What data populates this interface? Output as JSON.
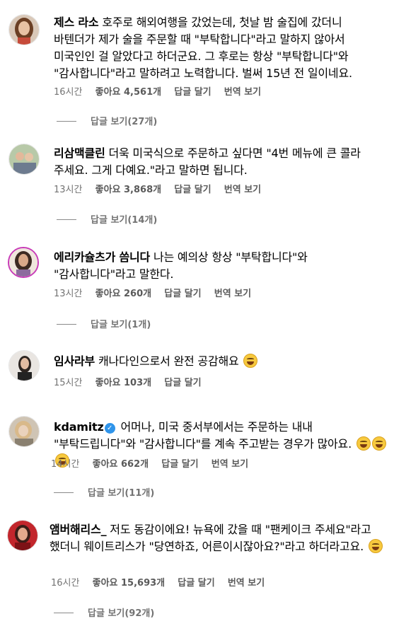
{
  "comments": [
    {
      "username": "제스 라소",
      "text": "호주로 해외여행을 갔었는데, 첫날 밤 술집에 갔더니 바텐더가 제가 술을 주문할 때 \"부탁합니다\"라고 말하지 않아서 미국인인 걸 알았다고 하더군요. 그 후로는 항상 \"부탁합니다\"와 \"감사합니다\"라고 말하려고 노력합니다. 벌써 15년 전 일이네요.",
      "time": "16시간",
      "likes": "좋아요 4,561개",
      "reply": "답글 달기",
      "translate": "번역 보기",
      "view_replies": "답글 보기(27개)"
    },
    {
      "username": "리삼맥클린",
      "text": "더욱 미국식으로 주문하고 싶다면 \"4번 메뉴에 큰 콜라 주세요. 그게 다예요.\"라고 말하면 됩니다.",
      "time": "13시간",
      "likes": "좋아요 3,868개",
      "reply": "답글 달기",
      "translate": "번역 보기",
      "view_replies": "답글 보기(14개)"
    },
    {
      "username": "에리카슐츠가 씀니다",
      "text": "나는 예의상 항상 \"부탁합니다\"와 \"감사합니다\"라고 말한다.",
      "time": "13시간",
      "likes": "좋아요 260개",
      "reply": "답글 달기",
      "translate": "번역 보기",
      "view_replies": "답글 보기(1개)"
    },
    {
      "username": "임사라부",
      "text": "캐나다인으로서 완전 공감해요",
      "time": "15시간",
      "likes": "좋아요 103개",
      "reply": "답글 달기"
    },
    {
      "username": "kdamitz",
      "text": "어머나, 미국 중서부에서는 주문하는 내내 \"부탁드립니다\"와 \"감사합니다\"를 계속 주고받는 경우가 많아요.",
      "time": "14시간",
      "likes": "좋아요 662개",
      "reply": "답글 달기",
      "translate": "번역 보기",
      "view_replies": "답글 보기(11개)"
    },
    {
      "username": "앰버해리스_",
      "text": "저도 동감이에요! 뉴욕에 갔을 때 \"팬케이크 주세요\"라고 했더니 웨이트리스가 \"당연하죠, 어른이시잖아요?\"라고 하더라고요.",
      "time": "16시간",
      "likes": "좋아요 15,693개",
      "reply": "답글 달기",
      "translate": "번역 보기",
      "view_replies": "답글 보기(92개)"
    }
  ],
  "icons": {
    "verified": "verified-badge-icon",
    "emoji_laugh": "tears-of-joy-emoji-icon",
    "emoji_tired": "tired-face-emoji-icon"
  },
  "colors": {
    "meta_text": "#737373",
    "verified_blue": "#2f94ea",
    "story_ring": "#c83cb8"
  }
}
